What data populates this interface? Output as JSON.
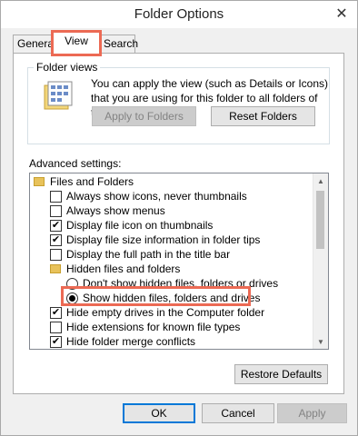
{
  "window": {
    "title": "Folder Options"
  },
  "tabs": [
    {
      "label": "General",
      "active": false
    },
    {
      "label": "View",
      "active": true
    },
    {
      "label": "Search",
      "active": false
    }
  ],
  "folder_views": {
    "legend": "Folder views",
    "description": "You can apply the view (such as Details or Icons) that you are using for this folder to all folders of this type.",
    "apply_button": "Apply to Folders",
    "reset_button": "Reset Folders"
  },
  "advanced": {
    "label": "Advanced settings:",
    "items": [
      {
        "type": "folder",
        "label": "Files and Folders"
      },
      {
        "type": "checkbox",
        "label": "Always show icons, never thumbnails",
        "checked": false
      },
      {
        "type": "checkbox",
        "label": "Always show menus",
        "checked": false
      },
      {
        "type": "checkbox",
        "label": "Display file icon on thumbnails",
        "checked": true
      },
      {
        "type": "checkbox",
        "label": "Display file size information in folder tips",
        "checked": true
      },
      {
        "type": "checkbox",
        "label": "Display the full path in the title bar",
        "checked": false
      },
      {
        "type": "folder",
        "label": "Hidden files and folders"
      },
      {
        "type": "radio",
        "label": "Don't show hidden files, folders or drives",
        "checked": false
      },
      {
        "type": "radio",
        "label": "Show hidden files, folders and drives",
        "checked": true
      },
      {
        "type": "checkbox",
        "label": "Hide empty drives in the Computer folder",
        "checked": true
      },
      {
        "type": "checkbox",
        "label": "Hide extensions for known file types",
        "checked": false
      },
      {
        "type": "checkbox",
        "label": "Hide folder merge conflicts",
        "checked": true
      }
    ],
    "restore_button": "Restore Defaults"
  },
  "footer": {
    "ok": "OK",
    "cancel": "Cancel",
    "apply": "Apply"
  },
  "colors": {
    "highlight": "#ec6a54",
    "accent": "#0078d7"
  }
}
